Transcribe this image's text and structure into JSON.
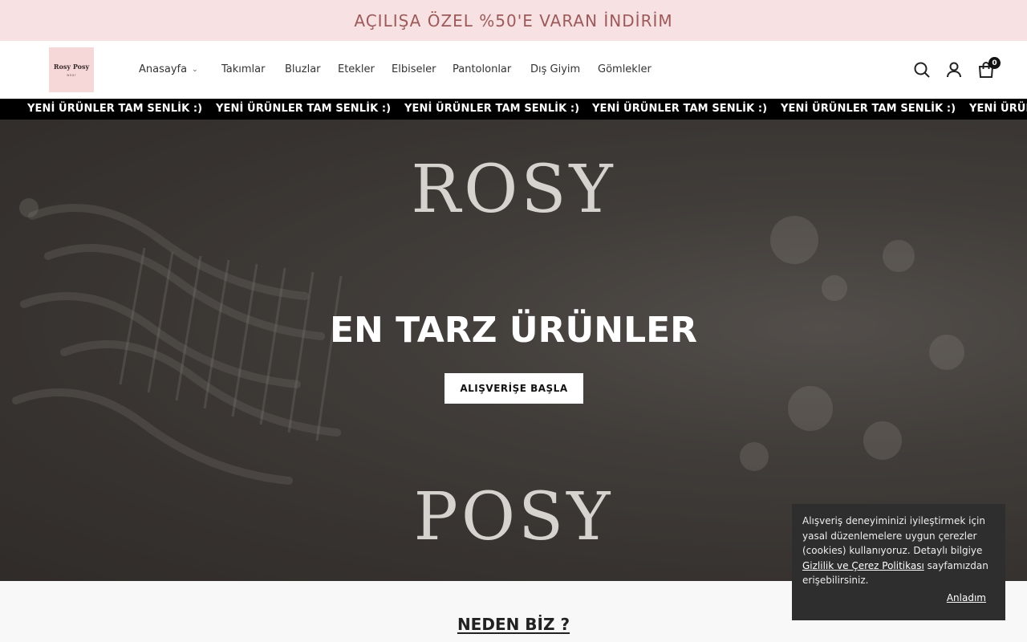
{
  "announcement": "AÇILIŞA ÖZEL %50'E VARAN İNDİRİM",
  "logo": {
    "line1": "Rosy Posy",
    "line2": "wear"
  },
  "nav": [
    {
      "label": "Anasayfa",
      "has_dropdown": true
    },
    {
      "label": "Takımlar"
    },
    {
      "label": "Bluzlar"
    },
    {
      "label": "Etekler"
    },
    {
      "label": "Elbiseler"
    },
    {
      "label": "Pantolonlar"
    },
    {
      "label": "Dış Giyim"
    },
    {
      "label": "Gömlekler"
    }
  ],
  "header_icons": {
    "search": "search-icon",
    "account": "user-icon",
    "cart": "shopping-bag-icon",
    "cart_count": "0"
  },
  "ticker": {
    "text": "YENİ ÜRÜNLER TAM SENLİK :)",
    "partial": "YENİ ÜRÜN"
  },
  "hero": {
    "brand_top": "ROSY",
    "title": "EN TARZ ÜRÜNLER",
    "cta": "ALIŞVERİŞE BAŞLA",
    "brand_bottom": "POSY"
  },
  "section": {
    "title": "NEDEN BİZ ?"
  },
  "cookie": {
    "text_before": "Alışveriş deneyiminizi iyileştirmek için yasal düzenlemelere uygun çerezler (cookies) kullanıyoruz. Detaylı bilgiye ",
    "link": "Gizlilik ve Çerez Politikası",
    "text_after": " sayfamızdan erişebilirsiniz.",
    "accept": "Anladım"
  },
  "colors": {
    "announcement_bg": "#f7e1e2",
    "announcement_text": "#9c5a5a",
    "ticker_bg": "#000000",
    "cookie_bg": "#2e2e2e"
  }
}
